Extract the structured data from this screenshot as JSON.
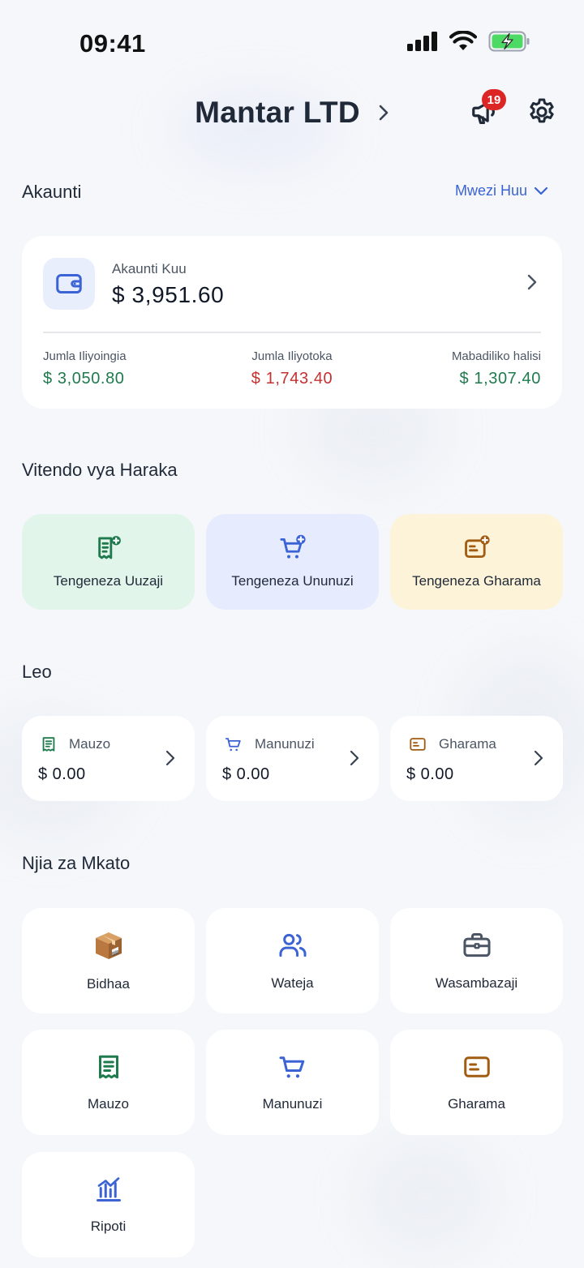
{
  "status_bar": {
    "time": "09:41"
  },
  "header": {
    "company_name": "Mantar LTD",
    "notification_count": "19"
  },
  "accounts": {
    "title": "Akaunti",
    "period_label": "Mwezi Huu",
    "main": {
      "label": "Akaunti Kuu",
      "balance": "$ 3,951.60"
    },
    "stats": [
      {
        "label": "Jumla Iliyoingia",
        "value": "$ 3,050.80",
        "color": "#1f7a4d"
      },
      {
        "label": "Jumla Iliyotoka",
        "value": "$ 1,743.40",
        "color": "#c53030"
      },
      {
        "label": "Mabadiliko halisi",
        "value": "$ 1,307.40",
        "color": "#1f7a4d"
      }
    ]
  },
  "quick_actions": {
    "title": "Vitendo vya Haraka",
    "items": [
      {
        "label": "Tengeneza Uuzaji",
        "icon": "receipt-add-icon",
        "bg": "#e2f5ea",
        "color": "#1f7a4d"
      },
      {
        "label": "Tengeneza Ununuzi",
        "icon": "cart-add-icon",
        "bg": "#e6ecfd",
        "color": "#3b63d6"
      },
      {
        "label": "Tengeneza Gharama",
        "icon": "expense-add-icon",
        "bg": "#fdf3d8",
        "color": "#a15c12"
      }
    ]
  },
  "today": {
    "title": "Leo",
    "items": [
      {
        "label": "Mauzo",
        "value": "$ 0.00",
        "icon": "receipt-icon"
      },
      {
        "label": "Manunuzi",
        "value": "$ 0.00",
        "icon": "cart-icon"
      },
      {
        "label": "Gharama",
        "value": "$ 0.00",
        "icon": "expense-icon"
      }
    ]
  },
  "shortcuts": {
    "title": "Njia za Mkato",
    "items": [
      {
        "label": "Bidhaa",
        "icon": "package-icon"
      },
      {
        "label": "Wateja",
        "icon": "users-icon"
      },
      {
        "label": "Wasambazaji",
        "icon": "briefcase-icon"
      },
      {
        "label": "Mauzo",
        "icon": "receipt-icon"
      },
      {
        "label": "Manunuzi",
        "icon": "cart-icon"
      },
      {
        "label": "Gharama",
        "icon": "expense-icon"
      },
      {
        "label": "Ripoti",
        "icon": "chart-icon"
      }
    ]
  }
}
